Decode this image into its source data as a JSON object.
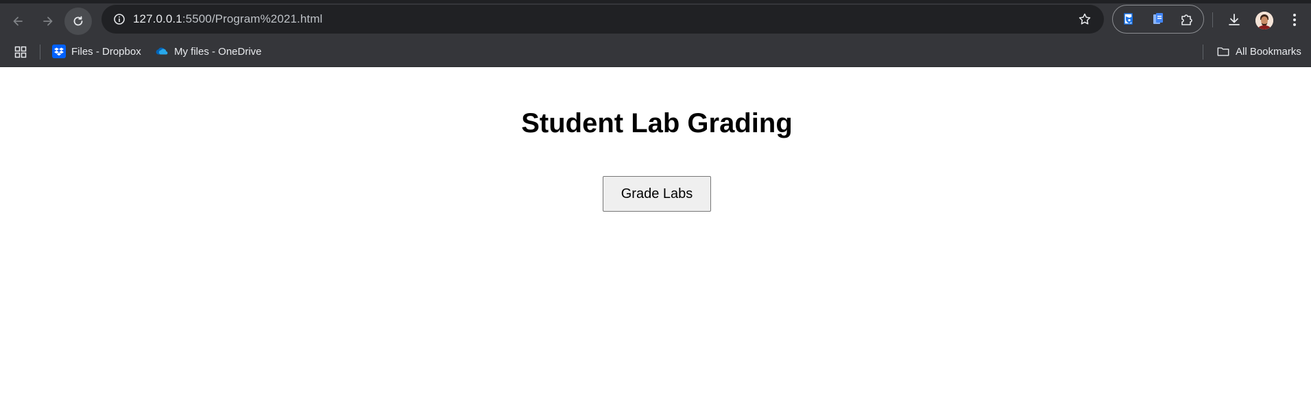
{
  "browser": {
    "url_host": "127.0.0.1",
    "url_path": ":5500/Program%2021.html",
    "icons": {
      "back": "arrow-left-icon",
      "forward": "arrow-right-icon",
      "reload": "reload-icon",
      "site_info": "info-icon",
      "bookmark_star": "star-icon",
      "download": "download-icon",
      "menu": "kebab-menu-icon",
      "apps": "apps-grid-icon"
    },
    "colors": {
      "toolbar_bg": "#35363a",
      "omnibox_bg": "#202124",
      "text": "#e8eaed"
    }
  },
  "bookmarks": {
    "items": [
      {
        "label": "Files - Dropbox",
        "icon": "dropbox-icon"
      },
      {
        "label": "My files - OneDrive",
        "icon": "onedrive-icon"
      }
    ],
    "all_bookmarks_label": "All Bookmarks"
  },
  "page": {
    "title": "Student Lab Grading",
    "grade_button_label": "Grade Labs"
  }
}
